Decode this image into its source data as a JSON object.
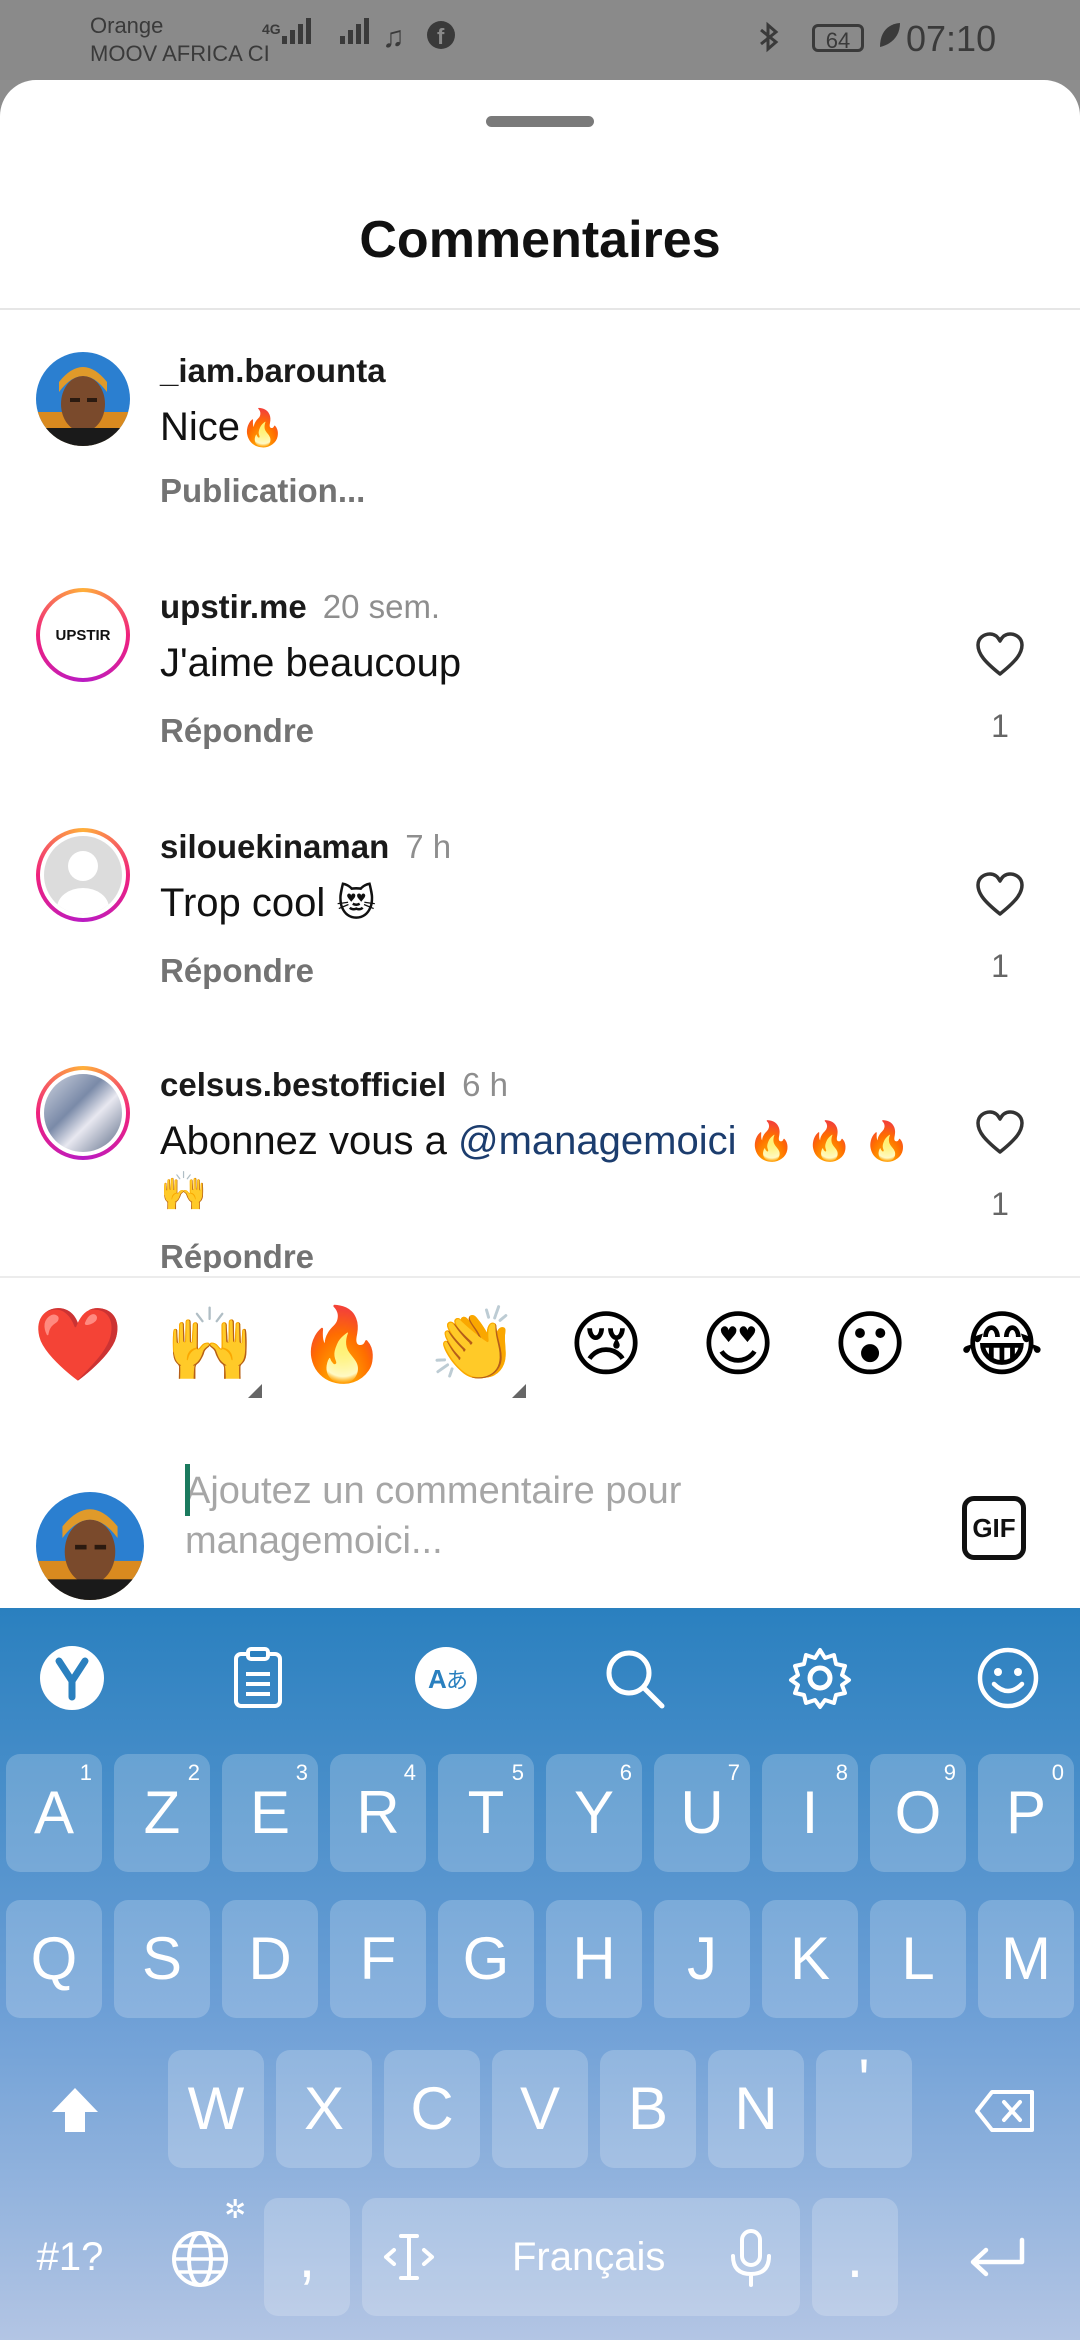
{
  "status_bar": {
    "carrier_line1": "Orange",
    "carrier_line2": "MOOV AFRICA CI",
    "network": "4G",
    "battery": "64",
    "time": "07:10"
  },
  "sheet": {
    "title": "Commentaires"
  },
  "comments": [
    {
      "username": "_iam.barounta",
      "time": "",
      "text": "Nice",
      "emoji": "🔥",
      "action": "Publication..."
    },
    {
      "username": "upstir.me",
      "time": "20 sem.",
      "text": "J'aime beaucoup",
      "action": "Répondre",
      "likes": "1",
      "avatar_text": "UPSTIR"
    },
    {
      "username": "silouekinaman",
      "time": "7 h",
      "text": "Trop cool",
      "emoji": "😻",
      "action": "Répondre",
      "likes": "1"
    },
    {
      "username": "celsus.bestofficiel",
      "time": "6 h",
      "text": "Abonnez vous a",
      "mention": "@managemoici",
      "emoji": "🔥 🔥 🔥",
      "text_line2": "🙌",
      "action": "Répondre",
      "likes": "1"
    }
  ],
  "emoji_bar": [
    "❤️",
    "🙌",
    "🔥",
    "👏",
    "😢",
    "😍",
    "😮",
    "😂"
  ],
  "composer": {
    "placeholder": "Ajoutez un commentaire pour managemoici...",
    "gif_label": "GIF"
  },
  "keyboard": {
    "toolbar_icons": [
      "yandex-logo-icon",
      "clipboard-icon",
      "translate-icon",
      "search-icon",
      "settings-gear-icon",
      "emoji-smile-icon"
    ],
    "row1": [
      {
        "key": "A",
        "num": "1"
      },
      {
        "key": "Z",
        "num": "2"
      },
      {
        "key": "E",
        "num": "3"
      },
      {
        "key": "R",
        "num": "4"
      },
      {
        "key": "T",
        "num": "5"
      },
      {
        "key": "Y",
        "num": "6"
      },
      {
        "key": "U",
        "num": "7"
      },
      {
        "key": "I",
        "num": "8"
      },
      {
        "key": "O",
        "num": "9"
      },
      {
        "key": "P",
        "num": "0"
      }
    ],
    "row2": [
      "Q",
      "S",
      "D",
      "F",
      "G",
      "H",
      "J",
      "K",
      "L",
      "M"
    ],
    "row3": [
      "W",
      "X",
      "C",
      "V",
      "B",
      "N",
      "'"
    ],
    "symbols_label": "#1?",
    "comma": ",",
    "space_label": "Français",
    "period": "."
  },
  "colors": {
    "mention": "#1c3d6e",
    "caret": "#1b7a5e",
    "keyboard_top": "#2a80bf"
  }
}
